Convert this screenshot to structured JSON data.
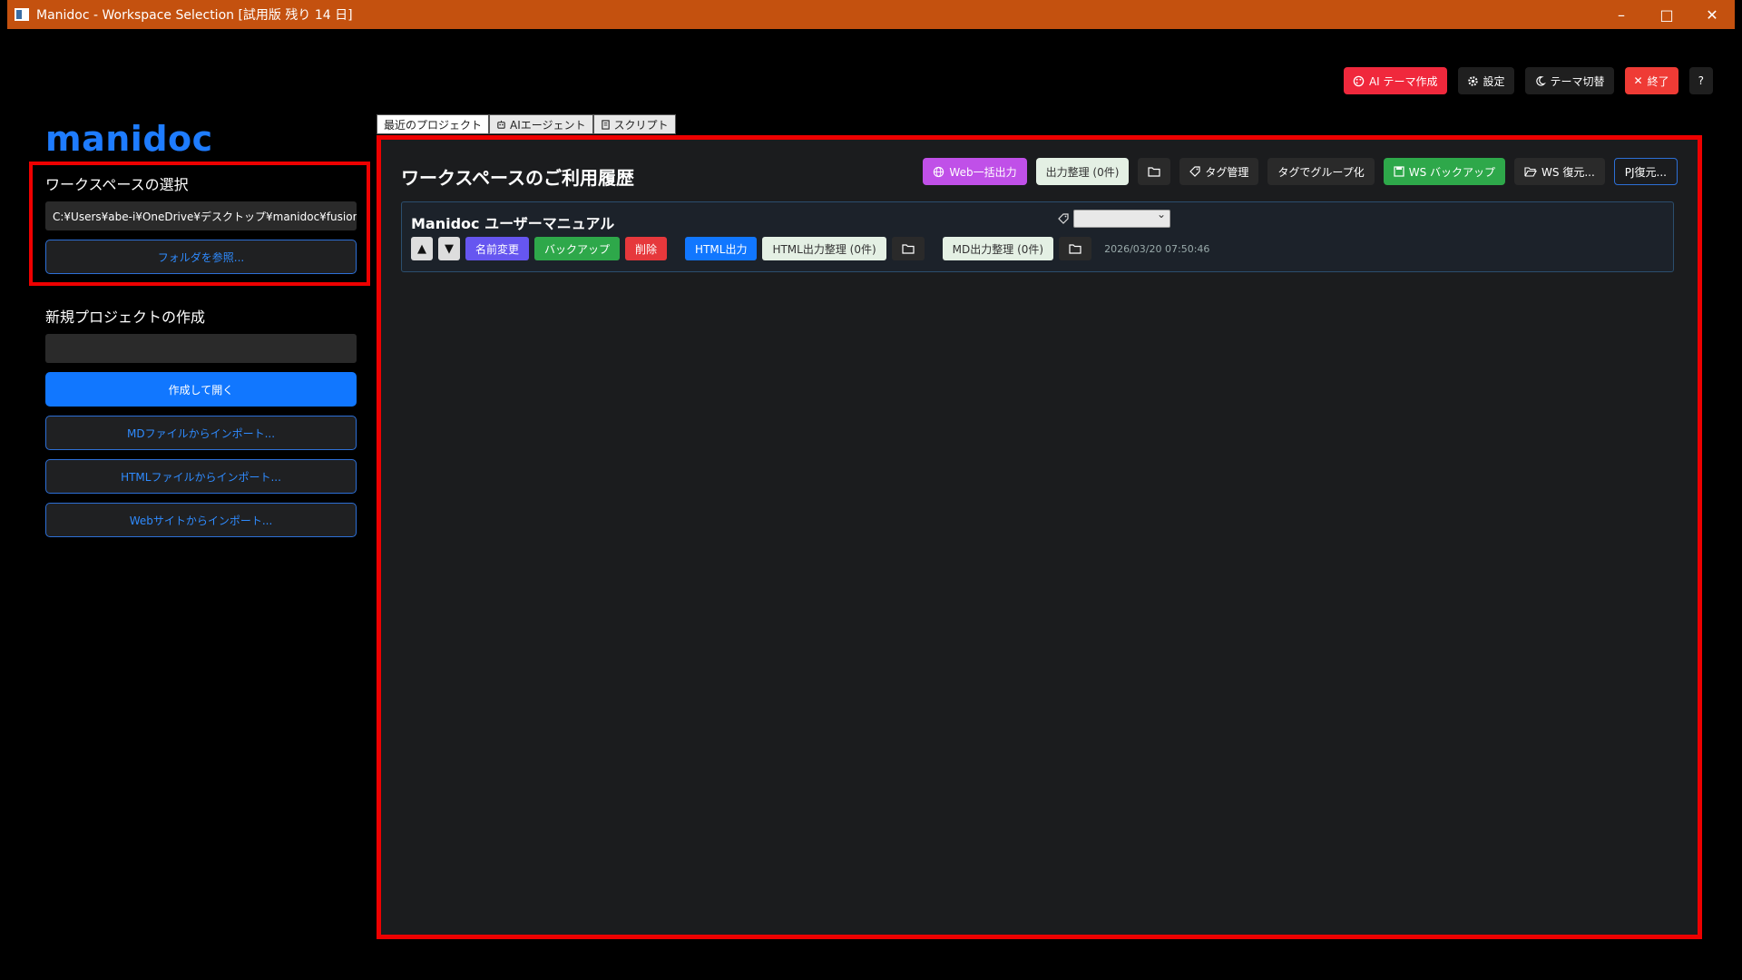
{
  "window": {
    "title": "Manidoc - Workspace Selection [試用版 残り 14 日]",
    "minimize": "–",
    "maximize": "□",
    "close": "✕"
  },
  "top_actions": {
    "ai_theme": "AI テーマ作成",
    "settings": "設定",
    "theme_switch": "テーマ切替",
    "exit": "終了",
    "help": "?"
  },
  "sidebar": {
    "logo": "manidoc",
    "workspace_label": "ワークスペースの選択",
    "workspace_path": "C:¥Users¥abe-i¥OneDrive¥デスクトップ¥manidoc¥fusion.upp",
    "browse_folder": "フォルダを参照...",
    "new_project_label": "新規プロジェクトの作成",
    "new_project_value": "",
    "create_open": "作成して開く",
    "import_md": "MDファイルからインポート...",
    "import_html": "HTMLファイルからインポート...",
    "import_web": "Webサイトからインポート..."
  },
  "tabs": [
    {
      "label": "最近のプロジェクト",
      "active": true
    },
    {
      "label": "AIエージェント",
      "active": false
    },
    {
      "label": "スクリプト",
      "active": false
    }
  ],
  "main": {
    "title": "ワークスペースのご利用履歴",
    "actions": {
      "web_bulk": "Web一括出力",
      "output_cleanup": "出力整理 (0件)",
      "tag_manage": "タグ管理",
      "group_by_tag": "タグでグループ化",
      "ws_backup": "WS バックアップ",
      "ws_restore": "WS 復元...",
      "pj_restore": "PJ復元..."
    },
    "projects": [
      {
        "name": "Manidoc ユーザーマニュアル",
        "tag_value": "",
        "move_up": "▲",
        "move_down": "▼",
        "rename": "名前変更",
        "backup": "バックアップ",
        "delete": "削除",
        "html_output": "HTML出力",
        "html_cleanup": "HTML出力整理 (0件)",
        "md_cleanup": "MD出力整理 (0件)",
        "timestamp": "2026/03/20 07:50:46"
      }
    ]
  },
  "colors": {
    "titlebar": "#c4510f",
    "accent_blue": "#1177ff",
    "highlight_red": "#ee0000"
  }
}
